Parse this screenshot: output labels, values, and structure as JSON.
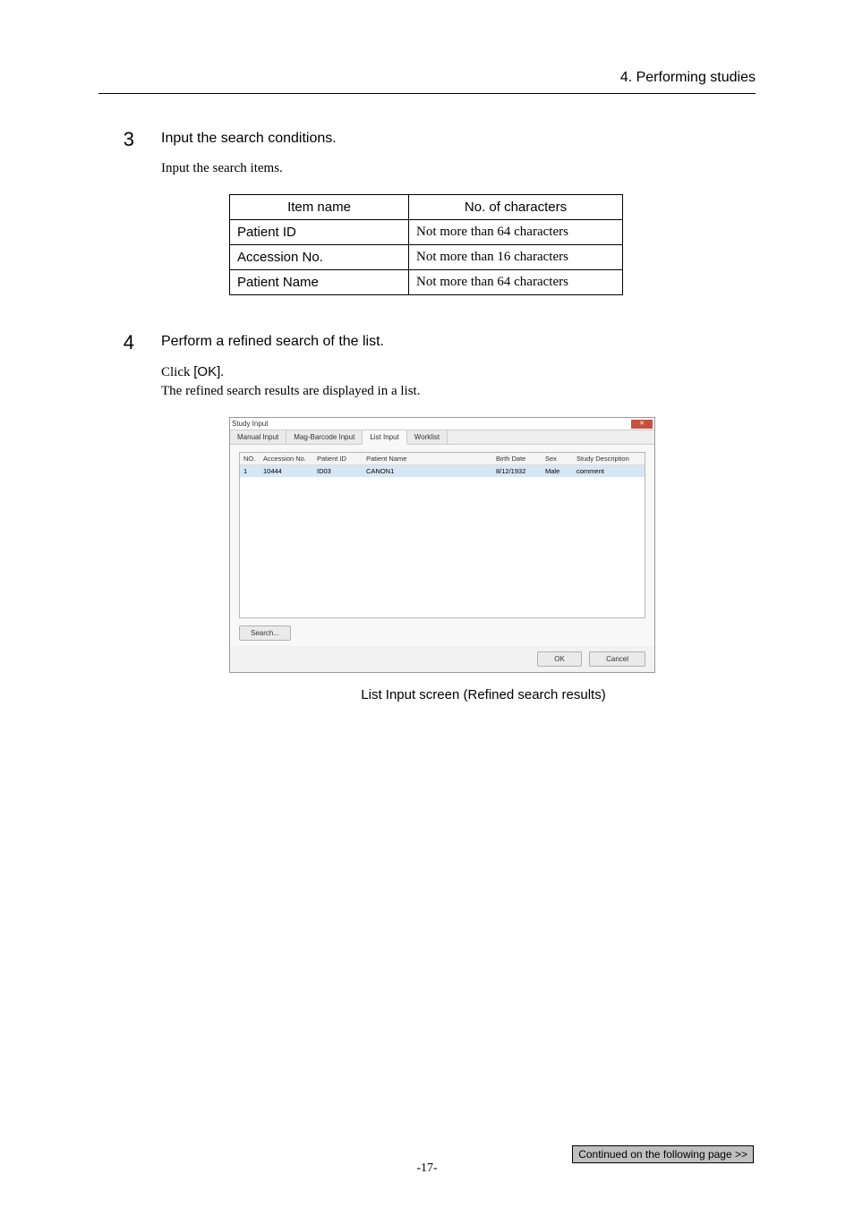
{
  "header": {
    "section": "4. Performing studies"
  },
  "step3": {
    "num": "3",
    "title": "Input the search conditions.",
    "desc": "Input the search items."
  },
  "spec_table": {
    "head": {
      "item": "Item name",
      "chars": "No. of characters"
    },
    "rows": [
      {
        "item": "Patient ID",
        "chars": "Not more than 64 characters"
      },
      {
        "item": "Accession No.",
        "chars": "Not more than 16 characters"
      },
      {
        "item": "Patient Name",
        "chars": "Not more than 64 characters"
      }
    ]
  },
  "step4": {
    "num": "4",
    "title": "Perform a refined search of the list.",
    "desc1_a": "Click ",
    "desc1_b": "[OK]",
    "desc1_c": ".",
    "desc2": "The refined search results are displayed in a list."
  },
  "dialog": {
    "title": "Study Input",
    "tabs": {
      "manual": "Manual Input",
      "mag": "Mag-Barcode Input",
      "list": "List Input",
      "worklist": "Worklist"
    },
    "list_headers": {
      "no": "NO.",
      "accession": "Accession No.",
      "pid": "Patient ID",
      "pname": "Patient Name",
      "bdate": "Birth Date",
      "sex": "Sex",
      "sdesc": "Study Description"
    },
    "list_row": {
      "no": "1",
      "accession": "10444",
      "pid": "ID03",
      "pname": "CANON1",
      "bdate": "8/12/1932",
      "sex": "Male",
      "sdesc": "comment"
    },
    "search_btn": "Search...",
    "ok_btn": "OK",
    "cancel_btn": "Cancel"
  },
  "caption": "List Input screen (Refined search results)",
  "continued": "Continued on the following page >>",
  "page_num": "-17-"
}
